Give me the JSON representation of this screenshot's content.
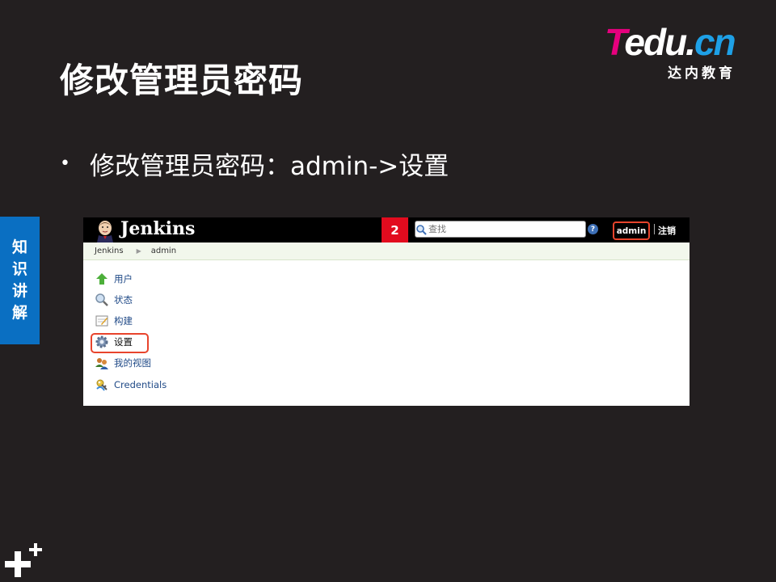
{
  "slide": {
    "title": "修改管理员密码",
    "bullet": "修改管理员密码：admin->设置",
    "side_tab": [
      "知",
      "识",
      "讲",
      "解"
    ]
  },
  "logo": {
    "brand_t": "T",
    "brand_edu": "edu.",
    "brand_cn": "cn",
    "subtitle": "达内教育"
  },
  "jenkins": {
    "brand": "Jenkins",
    "badge": "2",
    "search": {
      "placeholder": "查找"
    },
    "help": "?",
    "user": "admin",
    "logout": "注销",
    "breadcrumbs": [
      "Jenkins",
      "admin"
    ],
    "tasks": [
      {
        "label": "用户",
        "icon": "up-arrow-icon"
      },
      {
        "label": "状态",
        "icon": "magnifier-icon"
      },
      {
        "label": "构建",
        "icon": "notepad-icon"
      },
      {
        "label": "设置",
        "icon": "gear-icon"
      },
      {
        "label": "我的视图",
        "icon": "people-icon"
      },
      {
        "label": "Credentials",
        "icon": "key-icon"
      }
    ]
  },
  "colors": {
    "background": "#231f20",
    "side_tab": "#0a6fc2",
    "badge": "#e20b1e",
    "highlight": "#e8442c",
    "link": "#204a87"
  }
}
